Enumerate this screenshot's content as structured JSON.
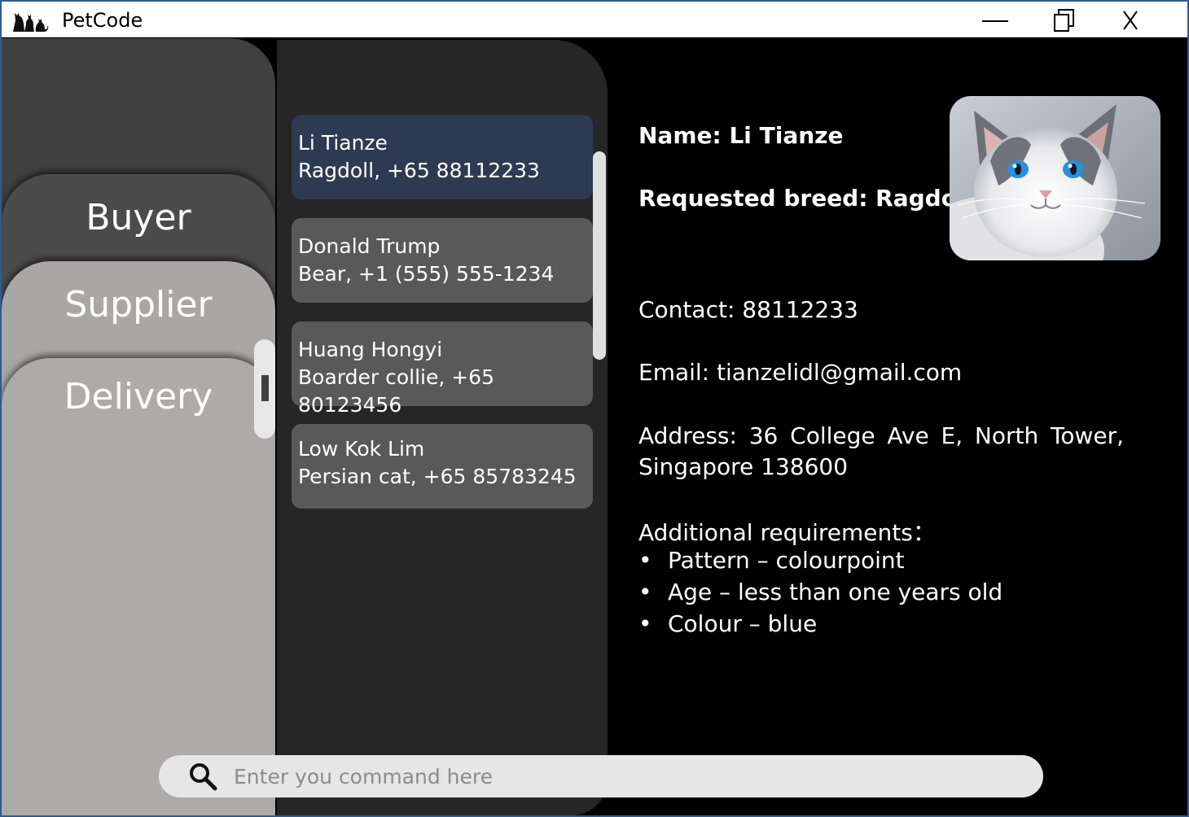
{
  "window": {
    "title": "PetCode",
    "controls": [
      "minimize",
      "maximize",
      "close"
    ]
  },
  "sidebar": {
    "tabs": [
      {
        "label": "Buyer",
        "active": true
      },
      {
        "label": "Supplier",
        "active": false
      },
      {
        "label": "Delivery",
        "active": false
      }
    ]
  },
  "list": {
    "items": [
      {
        "name": "Li Tianze",
        "detail": "Ragdoll, +65 88112233",
        "selected": true
      },
      {
        "name": "Donald Trump",
        "detail": "Bear, +1 (555) 555-1234",
        "selected": false
      },
      {
        "name": "Huang Hongyi",
        "detail": "Boarder collie, +65 80123456",
        "selected": false
      },
      {
        "name": "Low Kok Lim",
        "detail": "Persian cat, +65 85783245",
        "selected": false
      }
    ]
  },
  "detail": {
    "name": "Name: Li Tianze",
    "breed": "Requested breed: Ragdoll",
    "contact": "Contact: 88112233",
    "email": "Email: tianzelidl@gmail.com",
    "address": "Address: 36 College Ave E, North Tower, Singapore 138600",
    "requirements_label": "Additional requirements：",
    "requirements": [
      "Pattern – colourpoint",
      "Age – less than one years old",
      "Colour – blue"
    ],
    "photo": "ragdoll-cat-photo"
  },
  "command": {
    "placeholder": "Enter you command here",
    "icon": "search-icon"
  },
  "colors": {
    "window_border": "#2f5c8f",
    "sidebar_back": "#404040",
    "tab_buyer": "#4b4b4b",
    "tab_supplier": "#a9a6a5",
    "tab_delivery": "#aeaaa9",
    "list_panel": "#262626",
    "card_selected": "#2e3a52",
    "card_normal": "#595959",
    "detail_background": "#000000",
    "command_bar": "#e6e6e6"
  }
}
